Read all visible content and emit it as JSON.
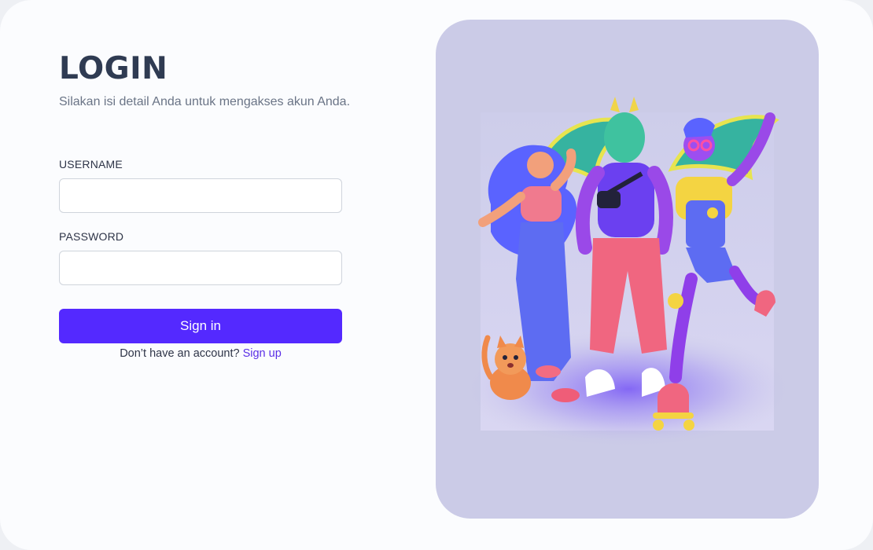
{
  "login": {
    "title": "LOGIN",
    "subtitle": "Silakan isi detail Anda untuk mengakses akun Anda.",
    "username_label": "USERNAME",
    "username_value": "",
    "password_label": "PASSWORD",
    "password_value": "",
    "signin_label": "Sign in",
    "signup_prompt": "Don’t have an account?",
    "signup_link": "Sign up"
  },
  "colors": {
    "accent": "#5429ff",
    "link": "#5a2ee6",
    "card_background": "#cbcbe7"
  },
  "illustration": {
    "icon": "characters-illustration"
  }
}
